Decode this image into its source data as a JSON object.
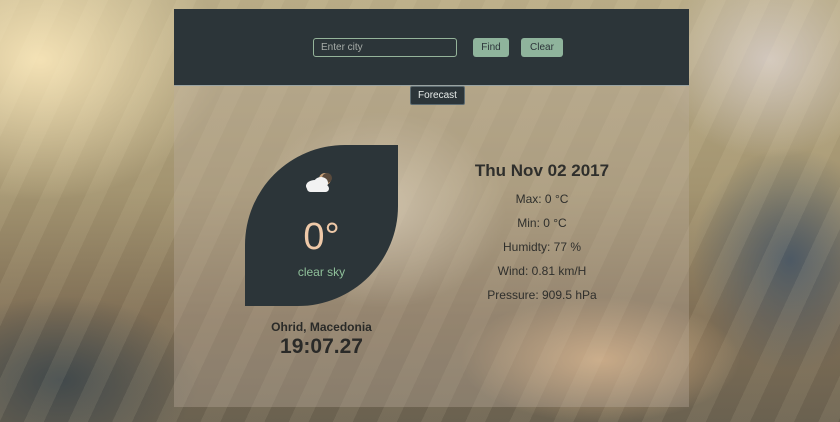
{
  "search": {
    "placeholder": "Enter city",
    "find_label": "Find",
    "clear_label": "Clear"
  },
  "forecast_label": "Forecast",
  "current": {
    "icon": "few-clouds-night-icon",
    "temperature": "0°",
    "description": "clear sky",
    "city": "Ohrid, Macedonia",
    "time": "19:07.27"
  },
  "details": {
    "date": "Thu Nov 02 2017",
    "max": "Max: 0 °C",
    "min": "Min: 0 °C",
    "humidity": "Humidty: 77 %",
    "wind": "Wind: 0.81 km/H",
    "pressure": "Pressure: 909.5 hPa"
  },
  "colors": {
    "bar_bg": "#2c3539",
    "accent_green": "#8fb49c",
    "temp_color": "#efc9a8"
  }
}
